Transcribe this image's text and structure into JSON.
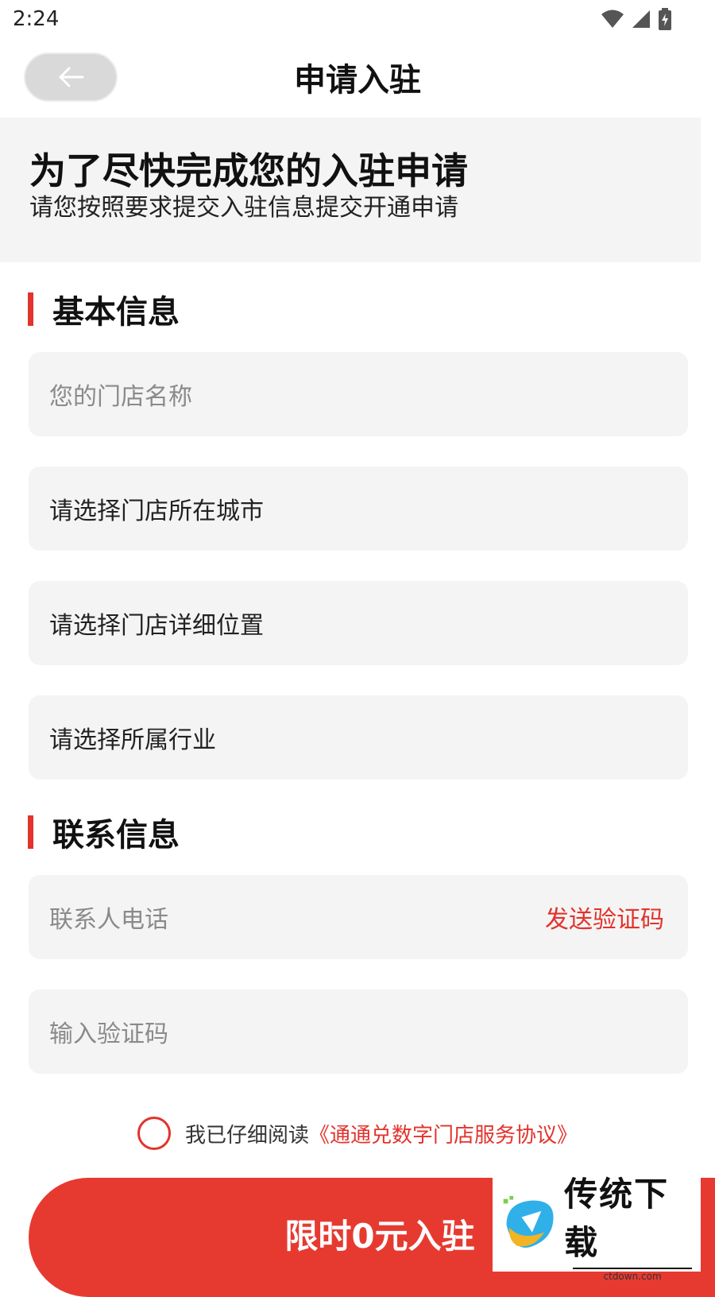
{
  "status_bar": {
    "time": "2:24"
  },
  "header": {
    "title": "申请入驻"
  },
  "banner": {
    "title": "为了尽快完成您的入驻申请",
    "subtitle": "请您按照要求提交入驻信息提交开通申请"
  },
  "basic_info": {
    "title": "基本信息",
    "store_name_placeholder": "您的门店名称",
    "city_label": "请选择门店所在城市",
    "address_label": "请选择门店详细位置",
    "industry_label": "请选择所属行业"
  },
  "contact_info": {
    "title": "联系信息",
    "phone_placeholder": "联系人电话",
    "send_code_label": "发送验证码",
    "code_placeholder": "输入验证码"
  },
  "agreement": {
    "prefix": "我已仔细阅读",
    "link": "《通通兑数字门店服务协议》"
  },
  "submit": {
    "label": "限时0元入驻"
  },
  "watermark": {
    "title": "传统下载",
    "subtitle": "ctdown.com"
  },
  "colors": {
    "accent": "#e2332c",
    "field_bg": "#f4f4f4"
  }
}
